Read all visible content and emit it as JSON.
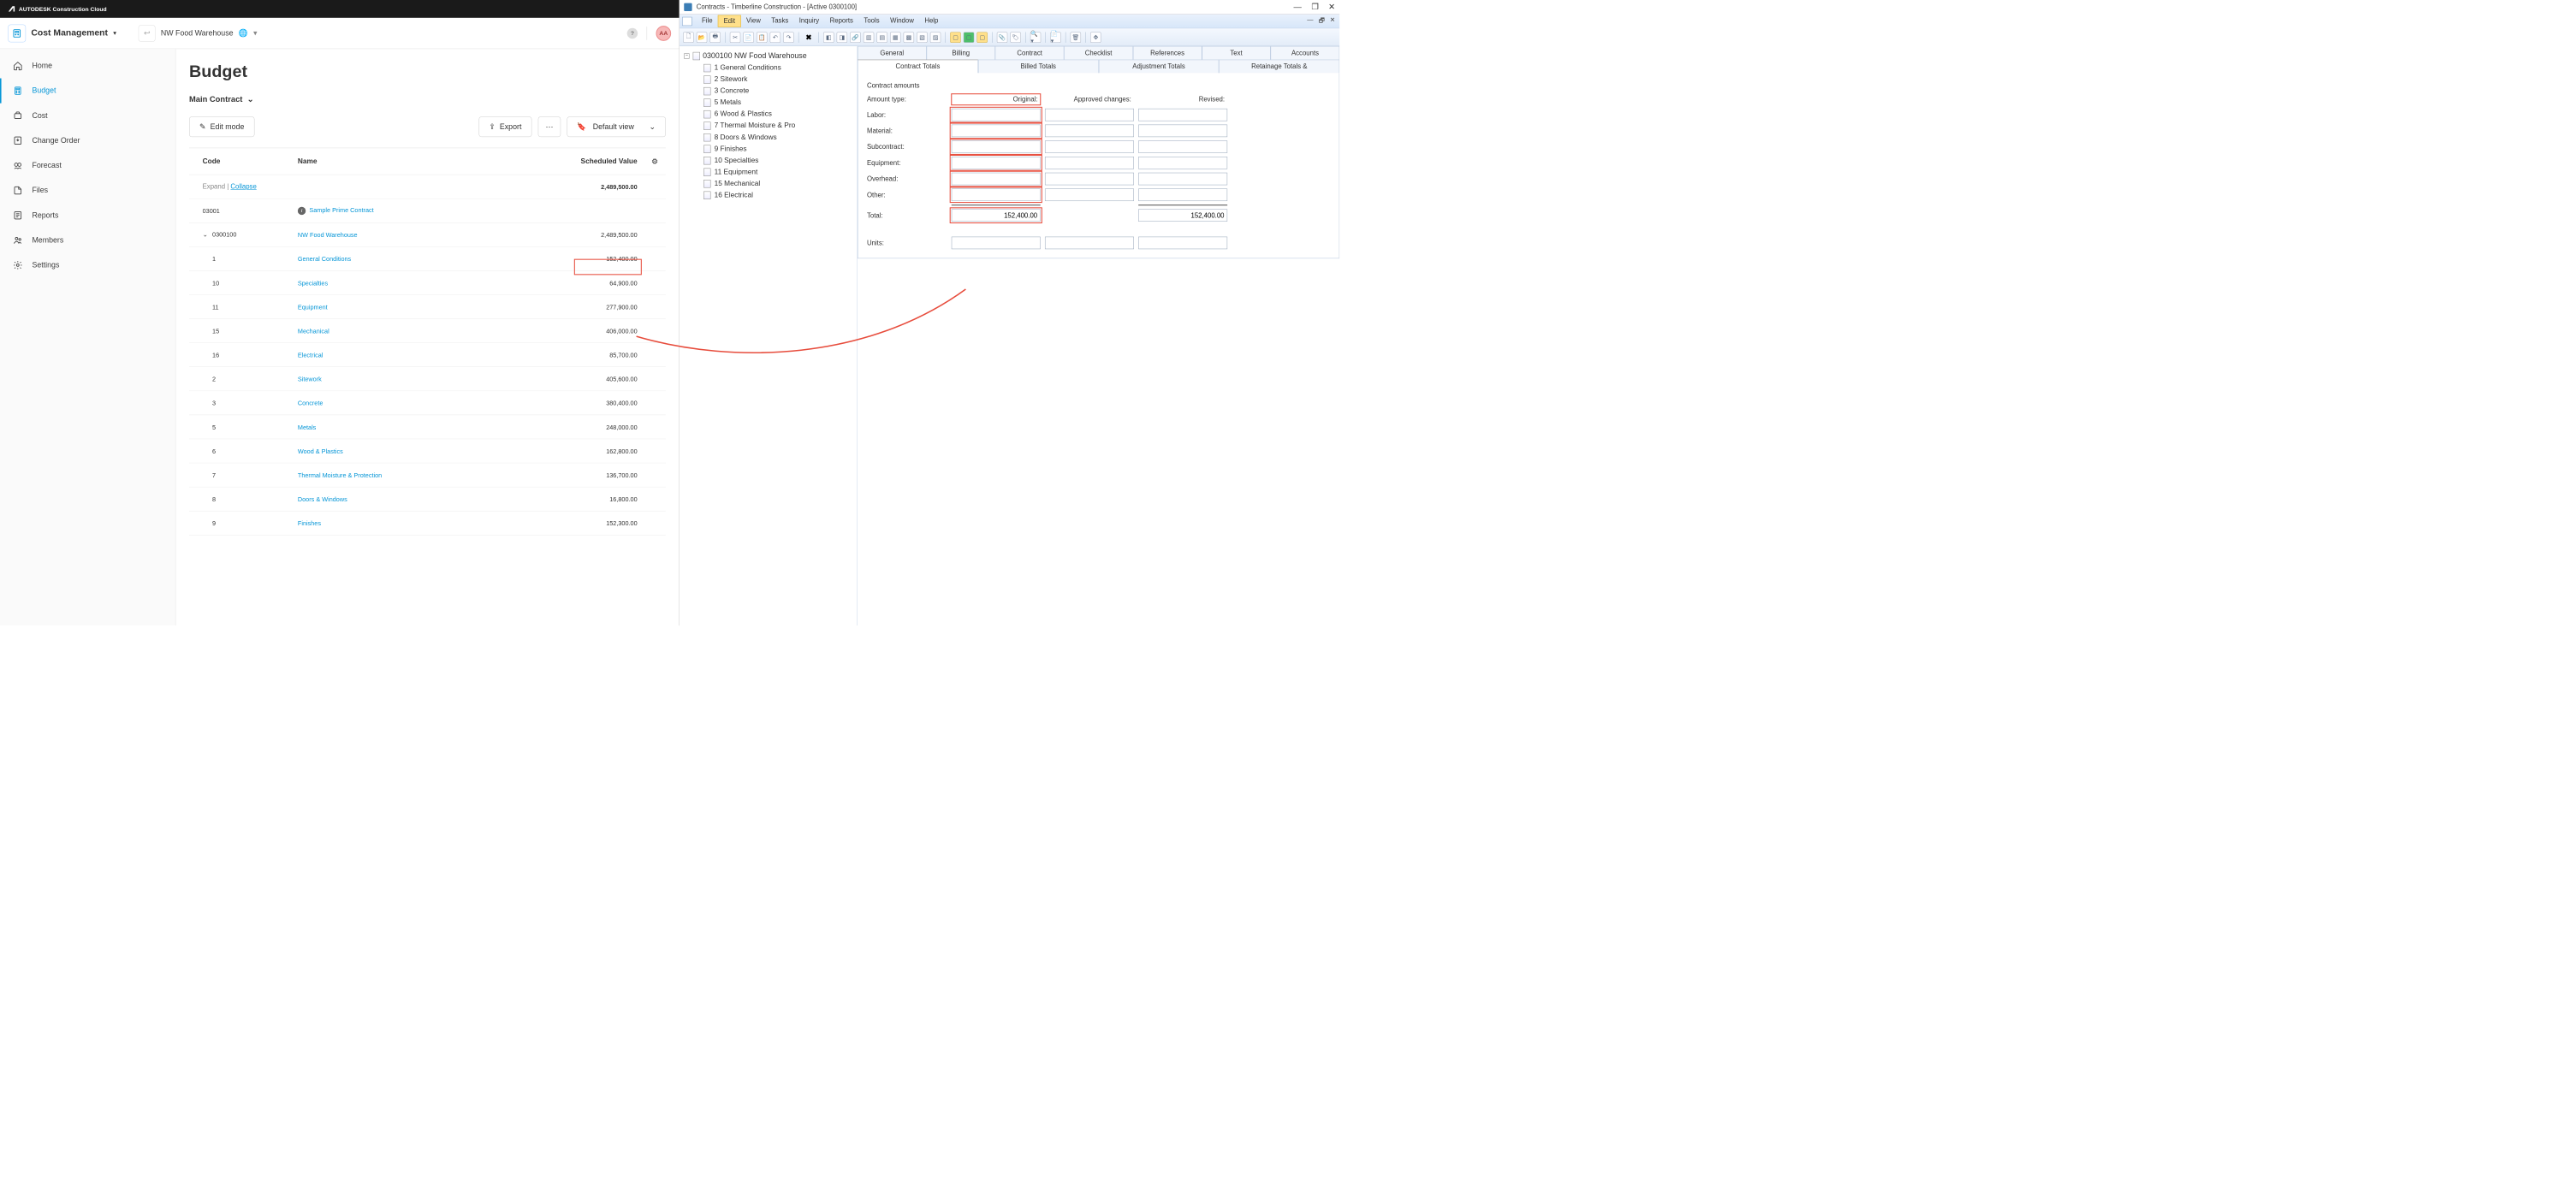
{
  "autodesk": {
    "brand": "AUTODESK Construction Cloud",
    "module_name": "Cost Management",
    "project_name": "NW Food Warehouse",
    "avatar_initials": "AA",
    "side_nav": [
      {
        "label": "Home",
        "icon": "home"
      },
      {
        "label": "Budget",
        "icon": "budget",
        "active": true
      },
      {
        "label": "Cost",
        "icon": "cost"
      },
      {
        "label": "Change Order",
        "icon": "change-order"
      },
      {
        "label": "Forecast",
        "icon": "forecast"
      },
      {
        "label": "Files",
        "icon": "files"
      },
      {
        "label": "Reports",
        "icon": "reports"
      },
      {
        "label": "Members",
        "icon": "members"
      },
      {
        "label": "Settings",
        "icon": "settings"
      }
    ],
    "page_title": "Budget",
    "main_contract": "Main Contract",
    "toolbar": {
      "edit_mode": "Edit mode",
      "export": "Export",
      "default_view": "Default view"
    },
    "table": {
      "headers": {
        "code": "Code",
        "name": "Name",
        "scheduled_value": "Scheduled Value"
      },
      "expand": "Expand",
      "collapse": "Collapse",
      "total": "2,489,500.00",
      "rows": [
        {
          "code": "03001",
          "name": "Sample Prime Contract",
          "value": "",
          "info": true,
          "indent": 0
        },
        {
          "code": "0300100",
          "name": "NW Food Warehouse",
          "value": "2,489,500.00",
          "chevron": true,
          "indent": 0
        },
        {
          "code": "1",
          "name": "General Conditions",
          "value": "152,400.00",
          "highlight": true,
          "indent": 1
        },
        {
          "code": "10",
          "name": "Specialties",
          "value": "64,900.00",
          "indent": 1
        },
        {
          "code": "11",
          "name": "Equipment",
          "value": "277,900.00",
          "indent": 1
        },
        {
          "code": "15",
          "name": "Mechanical",
          "value": "406,000.00",
          "indent": 1
        },
        {
          "code": "16",
          "name": "Electrical",
          "value": "85,700.00",
          "indent": 1
        },
        {
          "code": "2",
          "name": "Sitework",
          "value": "405,600.00",
          "indent": 1
        },
        {
          "code": "3",
          "name": "Concrete",
          "value": "380,400.00",
          "indent": 1
        },
        {
          "code": "5",
          "name": "Metals",
          "value": "248,000.00",
          "indent": 1
        },
        {
          "code": "6",
          "name": "Wood & Plastics",
          "value": "162,800.00",
          "indent": 1
        },
        {
          "code": "7",
          "name": "Thermal Moisture & Protection",
          "value": "136,700.00",
          "indent": 1
        },
        {
          "code": "8",
          "name": "Doors & Windows",
          "value": "16,800.00",
          "indent": 1
        },
        {
          "code": "9",
          "name": "Finishes",
          "value": "152,300.00",
          "indent": 1
        }
      ]
    }
  },
  "sage": {
    "window_title": "Contracts - Timberline Construction - [Active 0300100]",
    "menu": [
      "File",
      "Edit",
      "View",
      "Tasks",
      "Inquiry",
      "Reports",
      "Tools",
      "Window",
      "Help"
    ],
    "menu_active": "Edit",
    "tree": {
      "root": "0300100 NW Food Warehouse",
      "items": [
        "1 General Conditions",
        "2 Sitework",
        "3 Concrete",
        "5 Metals",
        "6 Wood & Plastics",
        "7 Thermal Moisture & Pro",
        "8 Doors & Windows",
        "9 Finishes",
        "10 Specialties",
        "11 Equipment",
        "15 Mechanical",
        "16 Electrical"
      ]
    },
    "tabs_top": [
      "General",
      "Billing",
      "Contract",
      "Checklist",
      "References",
      "Text",
      "Accounts"
    ],
    "tabs_sub": [
      "Contract Totals",
      "Billed Totals",
      "Adjustment Totals",
      "Retainage Totals &"
    ],
    "form": {
      "section_title": "Contract amounts",
      "col_headers": {
        "amount_type": "Amount type:",
        "original": "Original:",
        "approved": "Approved changes:",
        "revised": "Revised:"
      },
      "rows": [
        "Labor:",
        "Material:",
        "Subcontract:",
        "Equipment:",
        "Overhead:",
        "Other:"
      ],
      "total_label": "Total:",
      "original_total": "152,400.00",
      "revised_total": "152,400.00",
      "units_label": "Units:"
    }
  }
}
